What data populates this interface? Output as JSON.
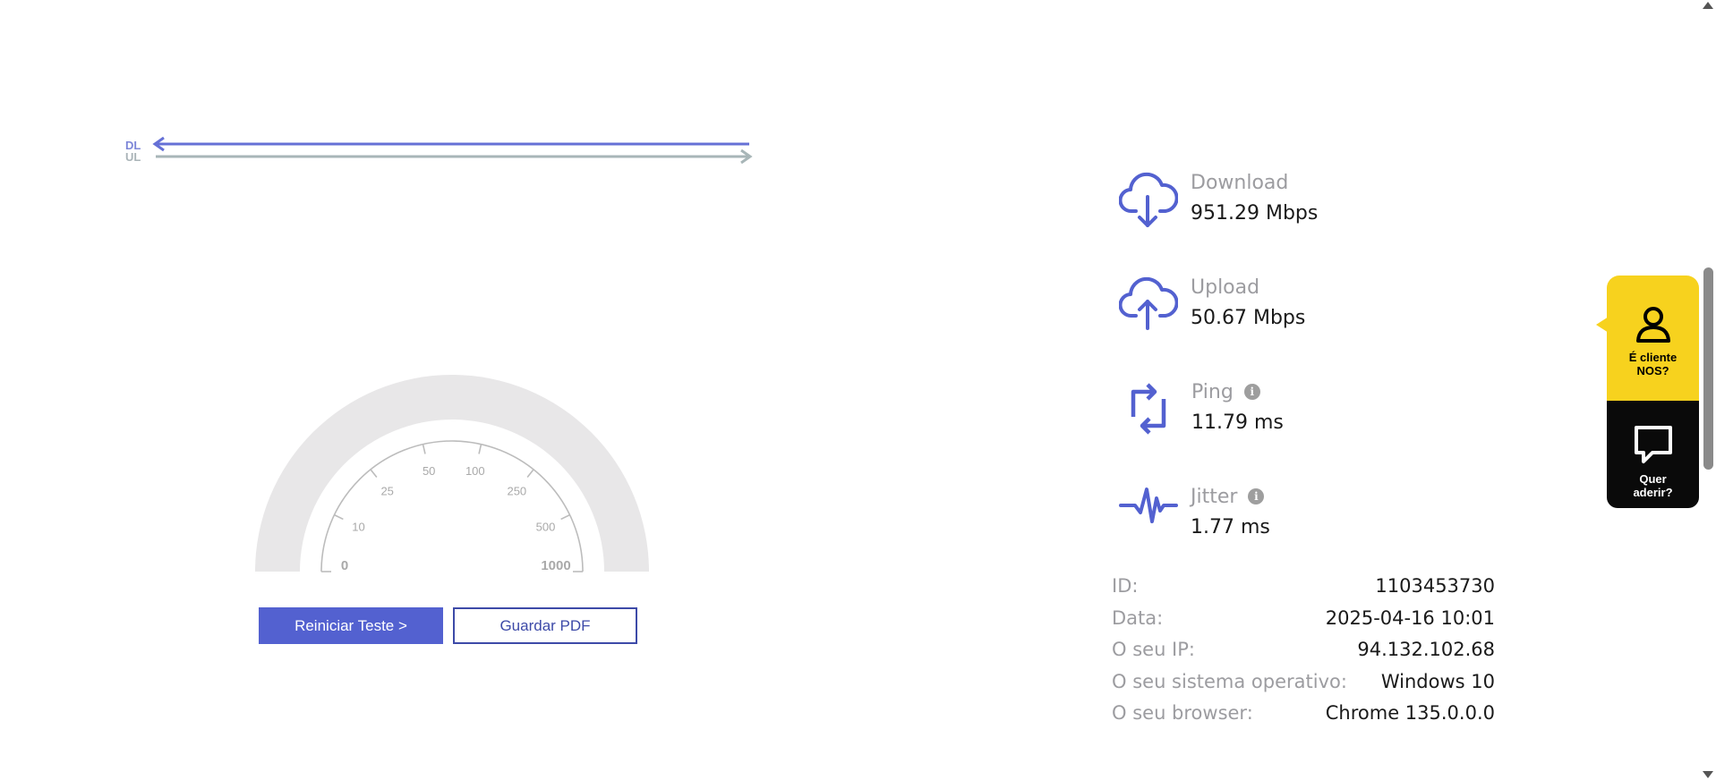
{
  "graph": {
    "dl_label": "DL",
    "ul_label": "UL"
  },
  "gauge": {
    "ticks": [
      "0",
      "10",
      "25",
      "50",
      "100",
      "250",
      "500",
      "1000"
    ]
  },
  "buttons": {
    "restart": "Reiniciar Teste >",
    "pdf": "Guardar PDF"
  },
  "metrics": {
    "download": {
      "label": "Download",
      "value": "951.29 Mbps"
    },
    "upload": {
      "label": "Upload",
      "value": "50.67 Mbps"
    },
    "ping": {
      "label": "Ping",
      "value": "11.79 ms"
    },
    "jitter": {
      "label": "Jitter",
      "value": "1.77 ms"
    }
  },
  "info": [
    {
      "key": "ID:",
      "value": "1103453730"
    },
    {
      "key": "Data:",
      "value": "2025-04-16 10:01"
    },
    {
      "key": "O seu IP:",
      "value": "94.132.102.68"
    },
    {
      "key": "O seu sistema operativo:",
      "value": "Windows 10"
    },
    {
      "key": "O seu browser:",
      "value": "Chrome 135.0.0.0"
    }
  ],
  "side_widget": {
    "client_line1": "É cliente",
    "client_line2": "NOS?",
    "join_line1": "Quer",
    "join_line2": "aderir?"
  },
  "colors": {
    "accent": "#5361d0",
    "dl_line": "#6570d6",
    "ul_line": "#a8b6b8",
    "gauge_arc": "#e8e7e8",
    "side_yellow": "#f7d21e"
  }
}
